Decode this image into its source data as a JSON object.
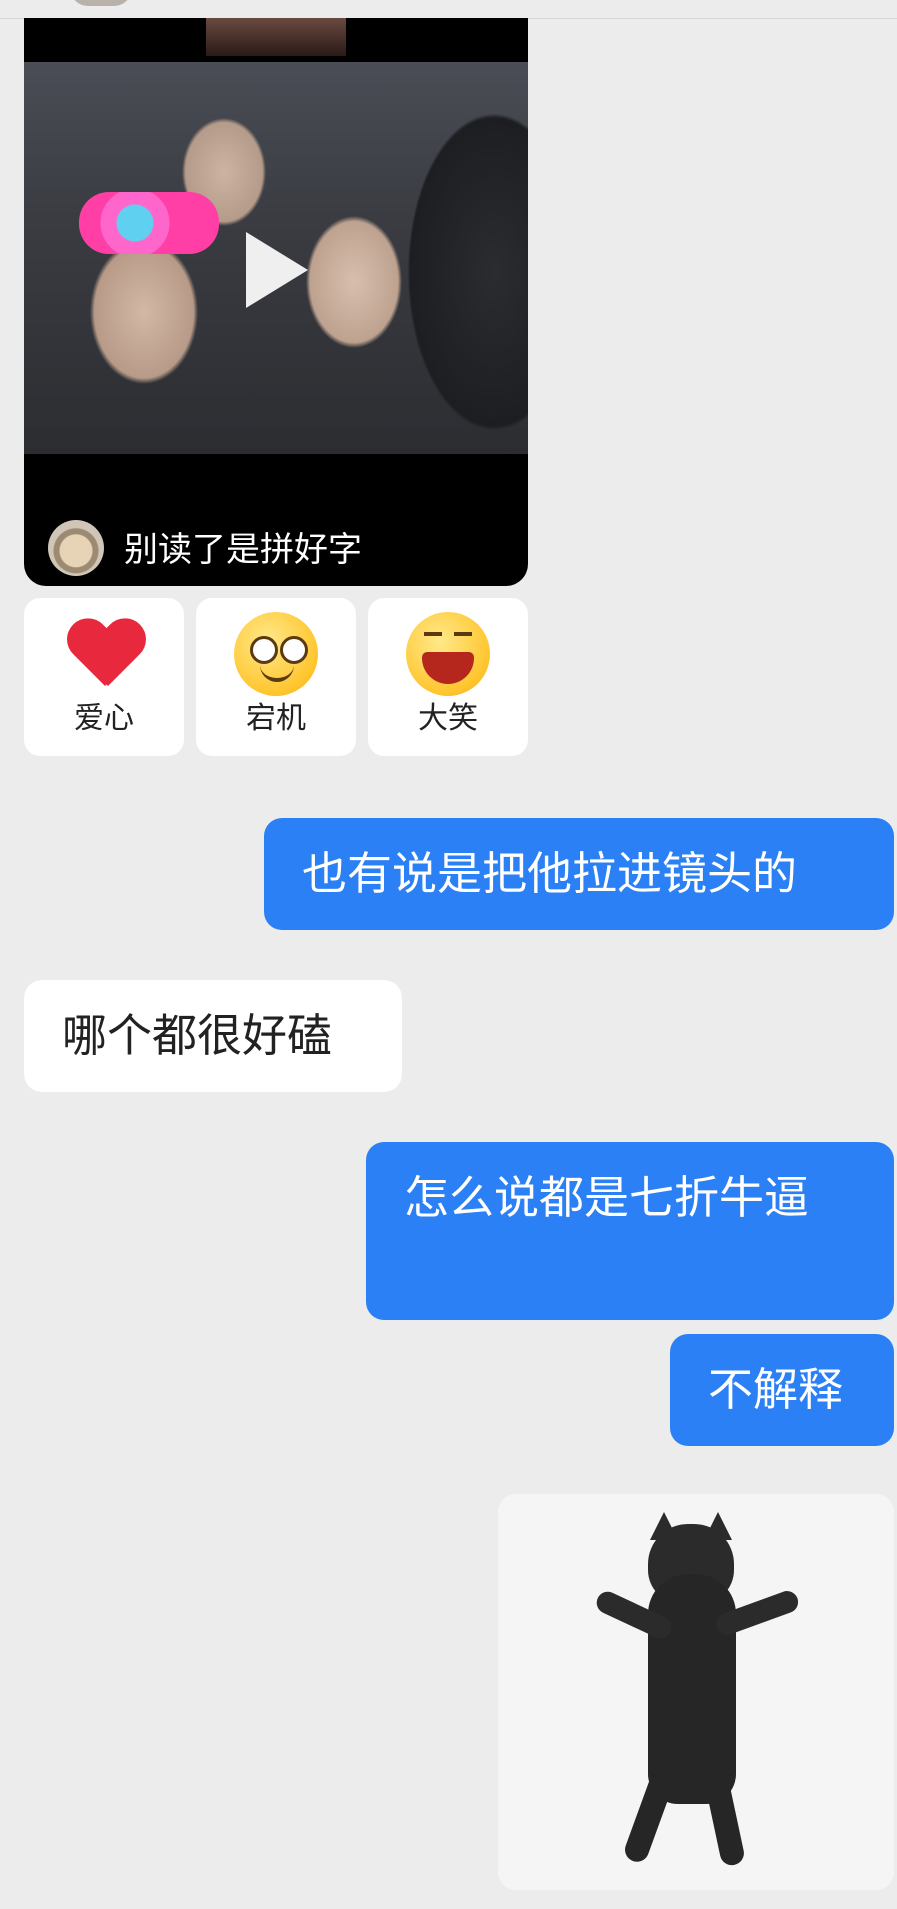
{
  "video": {
    "caption": "别读了是拼好字",
    "play_icon": "play-icon"
  },
  "reactions": [
    {
      "label": "爱心",
      "icon": "heart-icon"
    },
    {
      "label": "宕机",
      "icon": "dazed-face-icon"
    },
    {
      "label": "大笑",
      "icon": "laughing-face-icon"
    }
  ],
  "messages": [
    {
      "side": "me",
      "text": "也有说是把他拉进镜头的"
    },
    {
      "side": "them",
      "text": "哪个都很好磕"
    },
    {
      "side": "me",
      "text": "怎么说都是七折牛逼"
    },
    {
      "side": "me",
      "text": "不解释"
    }
  ],
  "sticker": {
    "icon": "dancing-cat-sticker"
  },
  "colors": {
    "background": "#ececec",
    "my_bubble": "#2c80f5",
    "their_bubble": "#ffffff"
  }
}
